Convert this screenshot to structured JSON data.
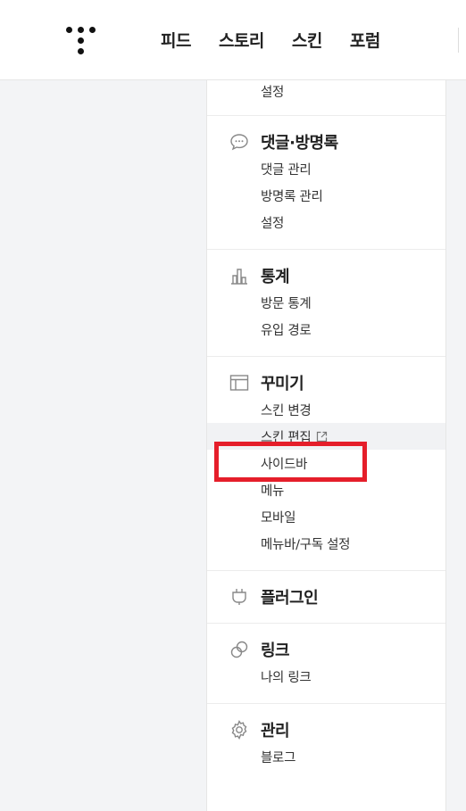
{
  "header": {
    "nav": [
      "피드",
      "스토리",
      "스킨",
      "포럼"
    ]
  },
  "sidebar": {
    "top_partial_item": "설정",
    "sections": [
      {
        "title": "댓글·방명록",
        "icon": "speech-bubble-icon",
        "items": [
          "댓글 관리",
          "방명록 관리",
          "설정"
        ]
      },
      {
        "title": "통계",
        "icon": "bar-chart-icon",
        "items": [
          "방문 통계",
          "유입 경로"
        ]
      },
      {
        "title": "꾸미기",
        "icon": "layout-icon",
        "items": [
          "스킨 변경",
          "스킨 편집",
          "사이드바",
          "메뉴",
          "모바일",
          "메뉴바/구독 설정"
        ]
      },
      {
        "title": "플러그인",
        "icon": "plug-icon",
        "items": []
      },
      {
        "title": "링크",
        "icon": "link-icon",
        "items": [
          "나의 링크"
        ]
      },
      {
        "title": "관리",
        "icon": "gear-icon",
        "items": [
          "블로그"
        ]
      }
    ]
  },
  "highlight": {
    "color": "#e51e2a",
    "target": "스킨 편집"
  }
}
